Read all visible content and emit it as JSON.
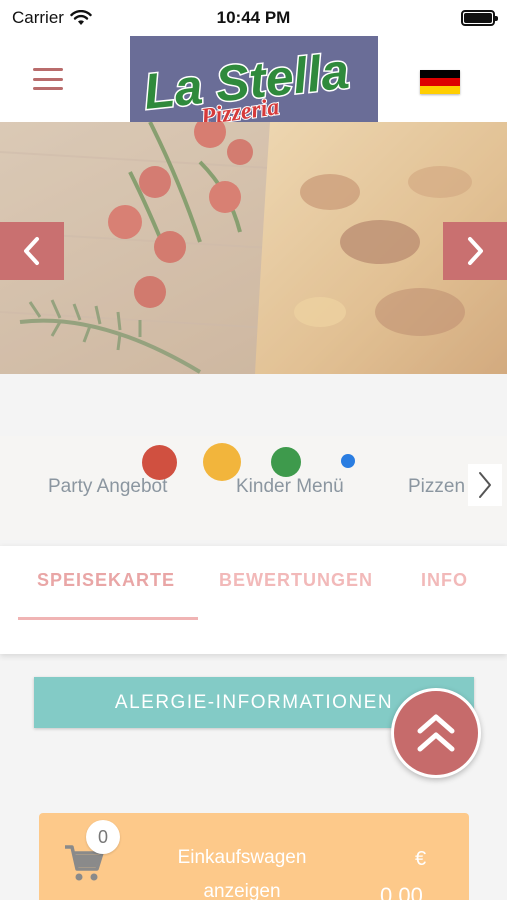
{
  "status_bar": {
    "carrier": "Carrier",
    "time": "10:44 PM",
    "battery_level": 1.0
  },
  "header": {
    "logo_text_main": "La Stella",
    "logo_text_sub": "Pizzeria",
    "language_flag": "german-flag-icon",
    "flag_colors": [
      "#000000",
      "#dd0000",
      "#ffce00"
    ]
  },
  "hero": {
    "image": "pizza-with-tomatoes-and-rosemary",
    "prev_icon": "chevron-left-icon",
    "next_icon": "chevron-right-icon"
  },
  "categories": {
    "items": [
      "Party Angebot",
      "Kinder Menü",
      "Pizzen"
    ],
    "indicator_colors": [
      "#d05040",
      "#f2b53c",
      "#3e9a4c",
      "#2a7de1"
    ],
    "next_icon": "chevron-right-icon"
  },
  "tabs": {
    "items": [
      "SPEISEKARTE",
      "BEWERTUNGEN",
      "INFO"
    ],
    "active": "SPEISEKARTE"
  },
  "allergy_button": {
    "label": "ALERGIE-INFORMATIONEN"
  },
  "scroll_top": {
    "icon": "double-chevron-up-icon"
  },
  "cart": {
    "count": "0",
    "label": "Einkaufswagen anzeigen",
    "currency": "€",
    "amount": "0.00"
  },
  "colors": {
    "accent": "#c66b6b",
    "teal": "#83cbc6",
    "cart": "#fdc98a",
    "tab_text": "#f2b9b9"
  }
}
